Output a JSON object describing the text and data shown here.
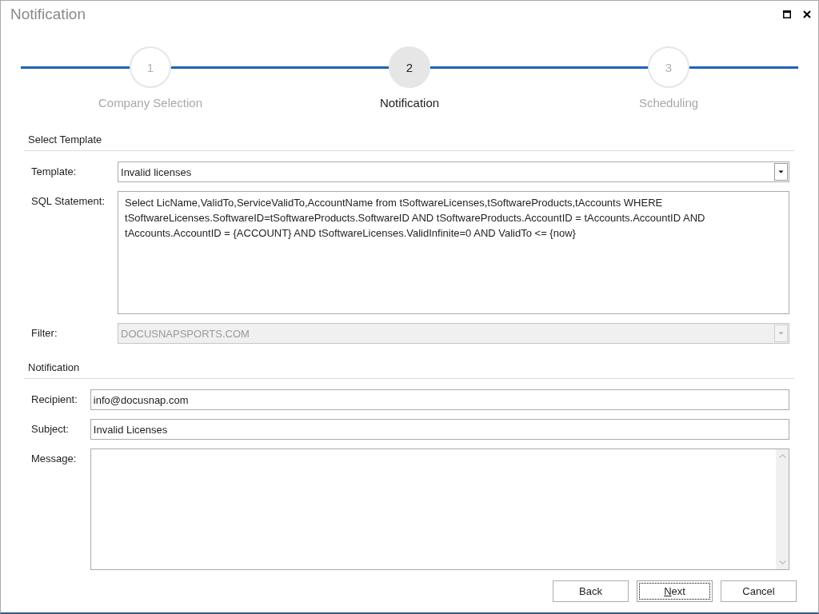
{
  "window": {
    "title": "Notification"
  },
  "steps": [
    {
      "number": "1",
      "label": "Company Selection",
      "selected": false
    },
    {
      "number": "2",
      "label": "Notification",
      "selected": true
    },
    {
      "number": "3",
      "label": "Scheduling",
      "selected": false
    }
  ],
  "sections": [
    {
      "title": "Select Template",
      "fields": [
        {
          "kind": "dropdown",
          "label": "Template:",
          "value": "Invalid licenses",
          "disabled": false
        },
        {
          "kind": "textarea",
          "label": "SQL Statement:",
          "value": "Select LicName,ValidTo,ServiceValidTo,AccountName from tSoftwareLicenses,tSoftwareProducts,tAccounts WHERE tSoftwareLicenses.SoftwareID=tSoftwareProducts.SoftwareID AND tSoftwareProducts.AccountID = tAccounts.AccountID AND tAccounts.AccountID = {ACCOUNT} AND tSoftwareLicenses.ValidInfinite=0 AND ValidTo <= {now}",
          "disabled": false
        },
        {
          "kind": "dropdown",
          "label": "Filter:",
          "value": "DOCUSNAPSPORTS.COM",
          "disabled": true
        }
      ]
    },
    {
      "title": "Notification",
      "fields": [
        {
          "kind": "text",
          "label": "Recipient:",
          "value": "info@docusnap.com",
          "disabled": false
        },
        {
          "kind": "text",
          "label": "Subject:",
          "value": "Invalid Licenses",
          "disabled": false
        },
        {
          "kind": "memo",
          "label": "Message:",
          "disabled": false
        }
      ]
    }
  ],
  "buttons": [
    {
      "label": "Back",
      "focused": false
    },
    {
      "label": "Next",
      "focused": true
    },
    {
      "label": "Cancel",
      "focused": false
    }
  ]
}
